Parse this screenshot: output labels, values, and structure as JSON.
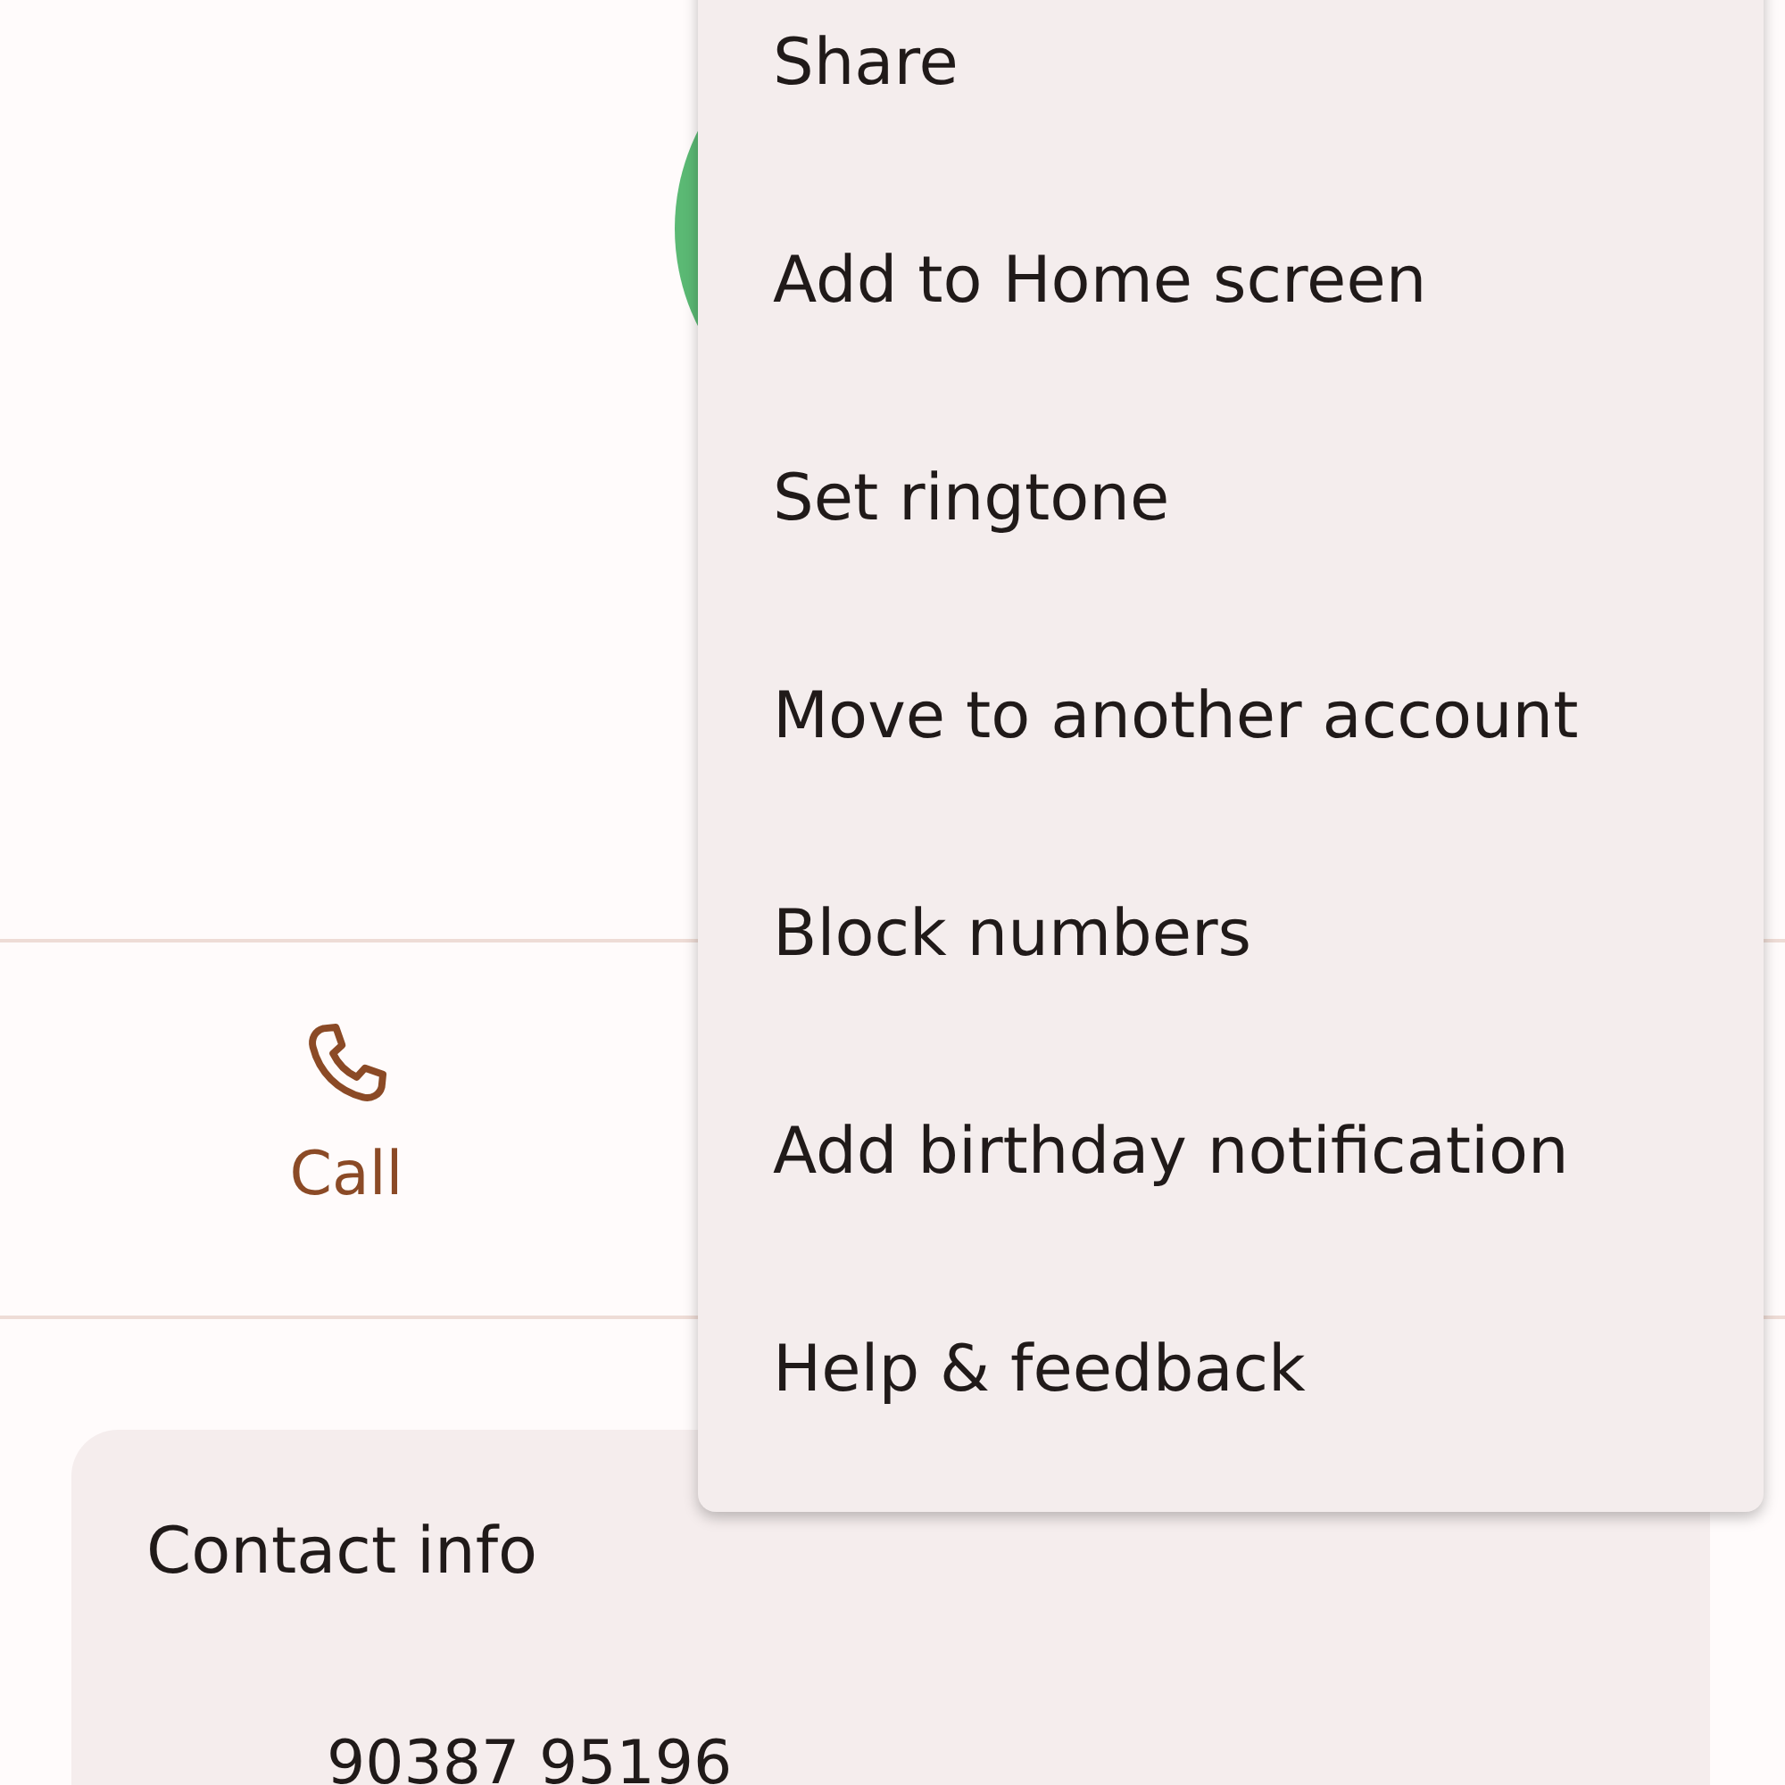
{
  "actions": [
    {
      "kind": "call",
      "label": "Call"
    }
  ],
  "contact_info": {
    "title": "Contact info",
    "phone": "90387 95196"
  },
  "menu": {
    "items": [
      "Share",
      "Add to Home screen",
      "Set ringtone",
      "Move to another account",
      "Block numbers",
      "Add birthday notification",
      "Help & feedback"
    ]
  }
}
